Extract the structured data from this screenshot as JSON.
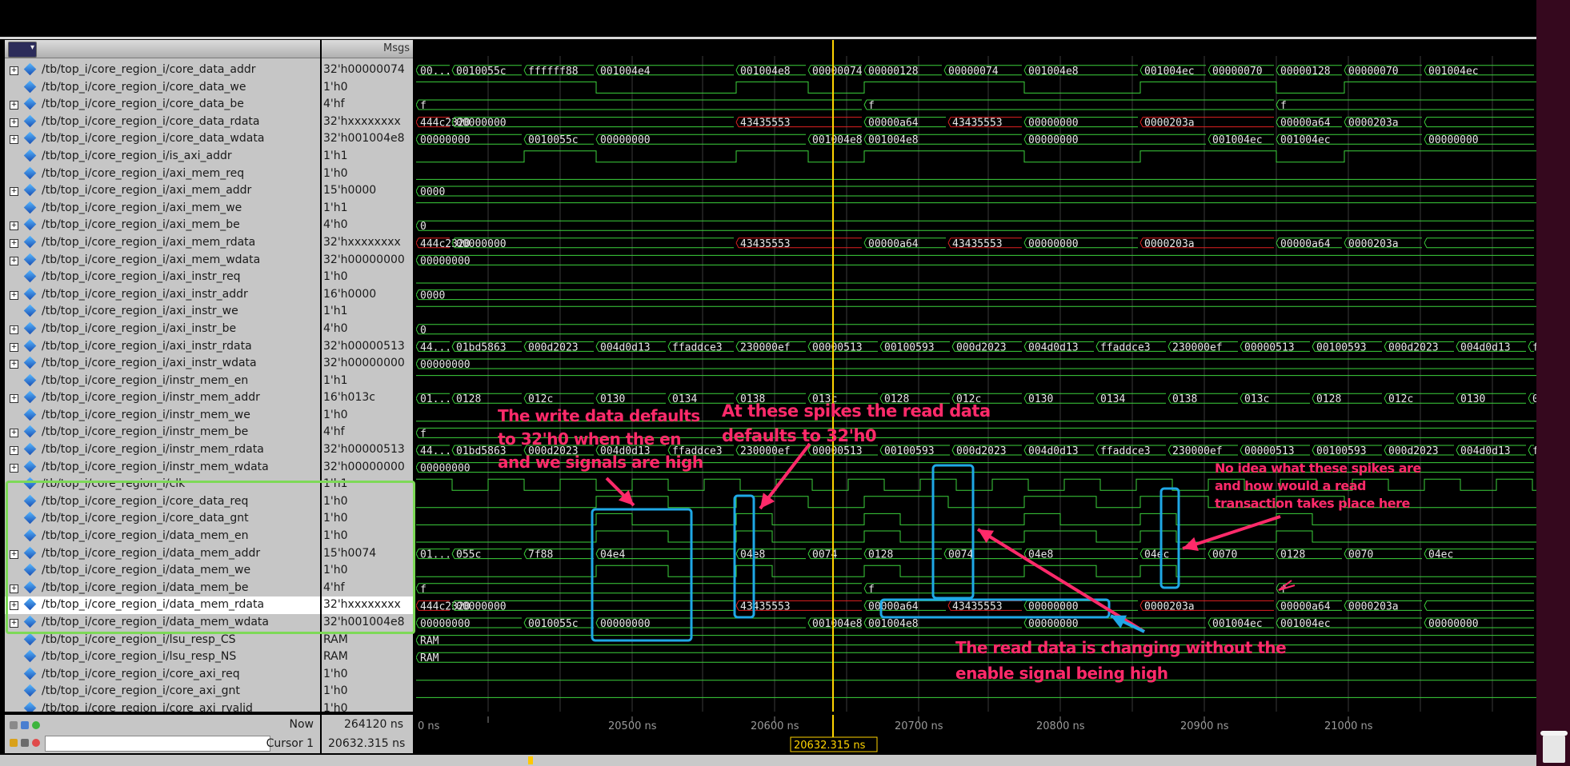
{
  "names_pane": {
    "header_label": ""
  },
  "values_pane": {
    "header_label": "Msgs"
  },
  "signals": [
    {
      "name": "/tb/top_i/core_region_i/core_data_addr",
      "value": "32'h00000074",
      "bus": true
    },
    {
      "name": "/tb/top_i/core_region_i/core_data_we",
      "value": "1'h0",
      "bus": false
    },
    {
      "name": "/tb/top_i/core_region_i/core_data_be",
      "value": "4'hf",
      "bus": true
    },
    {
      "name": "/tb/top_i/core_region_i/core_data_rdata",
      "value": "32'hxxxxxxxx",
      "bus": true
    },
    {
      "name": "/tb/top_i/core_region_i/core_data_wdata",
      "value": "32'h001004e8",
      "bus": true
    },
    {
      "name": "/tb/top_i/core_region_i/is_axi_addr",
      "value": "1'h1",
      "bus": false
    },
    {
      "name": "/tb/top_i/core_region_i/axi_mem_req",
      "value": "1'h0",
      "bus": false
    },
    {
      "name": "/tb/top_i/core_region_i/axi_mem_addr",
      "value": "15'h0000",
      "bus": true
    },
    {
      "name": "/tb/top_i/core_region_i/axi_mem_we",
      "value": "1'h1",
      "bus": false
    },
    {
      "name": "/tb/top_i/core_region_i/axi_mem_be",
      "value": "4'h0",
      "bus": true
    },
    {
      "name": "/tb/top_i/core_region_i/axi_mem_rdata",
      "value": "32'hxxxxxxxx",
      "bus": true
    },
    {
      "name": "/tb/top_i/core_region_i/axi_mem_wdata",
      "value": "32'h00000000",
      "bus": true
    },
    {
      "name": "/tb/top_i/core_region_i/axi_instr_req",
      "value": "1'h0",
      "bus": false
    },
    {
      "name": "/tb/top_i/core_region_i/axi_instr_addr",
      "value": "16'h0000",
      "bus": true
    },
    {
      "name": "/tb/top_i/core_region_i/axi_instr_we",
      "value": "1'h1",
      "bus": false
    },
    {
      "name": "/tb/top_i/core_region_i/axi_instr_be",
      "value": "4'h0",
      "bus": true
    },
    {
      "name": "/tb/top_i/core_region_i/axi_instr_rdata",
      "value": "32'h00000513",
      "bus": true
    },
    {
      "name": "/tb/top_i/core_region_i/axi_instr_wdata",
      "value": "32'h00000000",
      "bus": true
    },
    {
      "name": "/tb/top_i/core_region_i/instr_mem_en",
      "value": "1'h1",
      "bus": false
    },
    {
      "name": "/tb/top_i/core_region_i/instr_mem_addr",
      "value": "16'h013c",
      "bus": true
    },
    {
      "name": "/tb/top_i/core_region_i/instr_mem_we",
      "value": "1'h0",
      "bus": false
    },
    {
      "name": "/tb/top_i/core_region_i/instr_mem_be",
      "value": "4'hf",
      "bus": true
    },
    {
      "name": "/tb/top_i/core_region_i/instr_mem_rdata",
      "value": "32'h00000513",
      "bus": true
    },
    {
      "name": "/tb/top_i/core_region_i/instr_mem_wdata",
      "value": "32'h00000000",
      "bus": true
    },
    {
      "name": "/tb/top_i/core_region_i/clk",
      "value": "1'h1",
      "bus": false
    },
    {
      "name": "/tb/top_i/core_region_i/core_data_req",
      "value": "1'h0",
      "bus": false
    },
    {
      "name": "/tb/top_i/core_region_i/core_data_gnt",
      "value": "1'h0",
      "bus": false
    },
    {
      "name": "/tb/top_i/core_region_i/data_mem_en",
      "value": "1'h0",
      "bus": false
    },
    {
      "name": "/tb/top_i/core_region_i/data_mem_addr",
      "value": "15'h0074",
      "bus": true
    },
    {
      "name": "/tb/top_i/core_region_i/data_mem_we",
      "value": "1'h0",
      "bus": false
    },
    {
      "name": "/tb/top_i/core_region_i/data_mem_be",
      "value": "4'hf",
      "bus": true
    },
    {
      "name": "/tb/top_i/core_region_i/data_mem_rdata",
      "value": "32'hxxxxxxxx",
      "bus": true,
      "selected": true
    },
    {
      "name": "/tb/top_i/core_region_i/data_mem_wdata",
      "value": "32'h001004e8",
      "bus": true
    },
    {
      "name": "/tb/top_i/core_region_i/lsu_resp_CS",
      "value": "RAM",
      "bus": false
    },
    {
      "name": "/tb/top_i/core_region_i/lsu_resp_NS",
      "value": "RAM",
      "bus": false
    },
    {
      "name": "/tb/top_i/core_region_i/core_axi_req",
      "value": "1'h0",
      "bus": false
    },
    {
      "name": "/tb/top_i/core_region_i/core_axi_gnt",
      "value": "1'h0",
      "bus": false
    },
    {
      "name": "/tb/top_i/core_region_i/core_axi_rvalid",
      "value": "1'h0",
      "bus": false
    }
  ],
  "wave_labels": {
    "core_data_addr": [
      "00...",
      "0010055c",
      "ffffff88",
      "001004e4",
      "001004e8",
      "00000074",
      "00000128",
      "00000074",
      "001004e8",
      "001004ec",
      "00000070",
      "00000128",
      "00000070",
      "001004ec"
    ],
    "core_data_be": [
      "f",
      "f",
      "f"
    ],
    "core_data_rdata": [
      "444c2320",
      "00000000",
      "43435553",
      "00000a64",
      "43435553",
      "00000000",
      "0000203a",
      "00000a64",
      "0000203a"
    ],
    "core_data_wdata": [
      "00000000",
      "0010055c",
      "00000000",
      "001004e8",
      "001004e8",
      "00000000",
      "001004ec",
      "001004ec",
      "00000000"
    ],
    "axi_mem_addr": [
      "0000"
    ],
    "axi_mem_be": [
      "0"
    ],
    "axi_mem_rdata": [
      "444c2320",
      "00000000",
      "43435553",
      "00000a64",
      "43435553",
      "00000000",
      "0000203a",
      "00000a64",
      "0000203a"
    ],
    "axi_mem_wdata": [
      "00000000"
    ],
    "axi_instr_addr": [
      "0000"
    ],
    "axi_instr_be": [
      "0"
    ],
    "axi_instr_rdata": [
      "44...",
      "01bd5863",
      "000d2023",
      "004d0d13",
      "ffaddce3",
      "230000ef",
      "00000513",
      "00100593",
      "000d2023",
      "004d0d13",
      "ffaddce3",
      "230000ef",
      "00000513",
      "00100593",
      "000d2023",
      "004d0d13",
      "ff"
    ],
    "axi_instr_wdata": [
      "00000000"
    ],
    "instr_mem_addr": [
      "01...",
      "0128",
      "012c",
      "0130",
      "0134",
      "0138",
      "013c",
      "0128",
      "012c",
      "0130",
      "0134",
      "0138",
      "013c",
      "0128",
      "012c",
      "0130",
      "0"
    ],
    "instr_mem_be": [
      "f"
    ],
    "instr_mem_rdata": [
      "44...",
      "01bd5863",
      "000d2023",
      "004d0d13",
      "ffaddce3",
      "230000ef",
      "00000513",
      "00100593",
      "000d2023",
      "004d0d13",
      "ffaddce3",
      "230000ef",
      "00000513",
      "00100593",
      "000d2023",
      "004d0d13",
      "ff"
    ],
    "instr_mem_wdata": [
      "00000000"
    ],
    "data_mem_addr": [
      "01...",
      "055c",
      "7f88",
      "04e4",
      "04e8",
      "0074",
      "0128",
      "0074",
      "04e8",
      "04ec",
      "0070",
      "0128",
      "0070",
      "04ec"
    ],
    "data_mem_be": [
      "f",
      "f",
      "f"
    ],
    "data_mem_rdata": [
      "444c2320",
      "00000000",
      "43435553",
      "00000a64",
      "43435553",
      "00000000",
      "0000203a",
      "00000a64",
      "0000203a"
    ],
    "data_mem_wdata": [
      "00000000",
      "0010055c",
      "00000000",
      "001004e8",
      "001004e8",
      "00000000",
      "001004ec",
      "001004ec",
      "00000000"
    ],
    "lsu_resp_CS": [
      "RAM"
    ],
    "lsu_resp_NS": [
      "RAM"
    ]
  },
  "cursor": {
    "label": "Cursor 1",
    "value": "20632.315 ns",
    "flag": "20632.315 ns"
  },
  "now": {
    "label": "Now",
    "value": "264120 ns"
  },
  "timeline": {
    "ticks": [
      "0 ns",
      "20500 ns",
      "20600 ns",
      "20700 ns",
      "20800 ns",
      "20900 ns",
      "21000 ns"
    ]
  },
  "annotations": {
    "write_default": "The write data defaults\nto 32'h0 when the en\nand we signals are high",
    "read_spike": "At these spikes the read data\ndefaults to 32'h0",
    "no_idea": "No idea what these spikes are\nand how would a read\ntransaction takes place here",
    "read_changing": "The read data is changing without the\nenable signal being high"
  },
  "colors": {
    "wave": "#3cd23c",
    "x_state": "#e02020",
    "cursor": "#ffd400",
    "annotation": "#ff2a6a",
    "callout_box": "#1fa8e6",
    "selection_box": "#7dd957"
  }
}
